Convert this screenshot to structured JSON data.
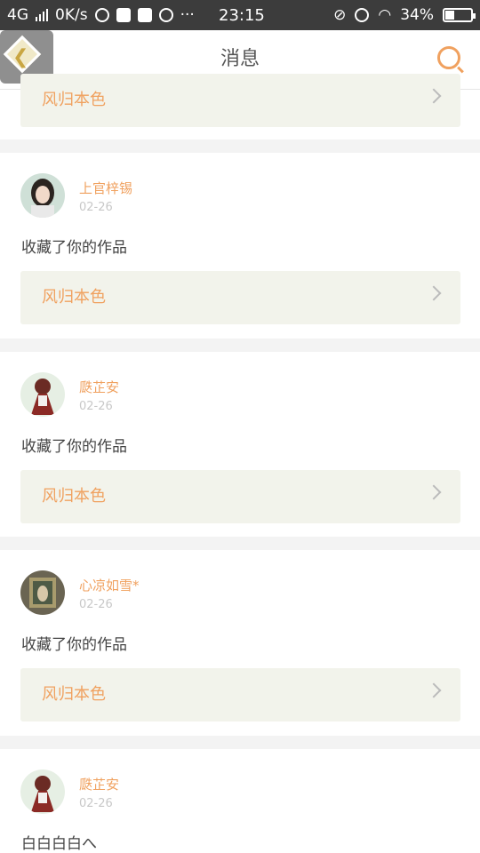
{
  "status_bar": {
    "network": "4G",
    "speed": "0K/s",
    "time": "23:15",
    "battery": "34%",
    "battery_level": 0.34,
    "left_icons": [
      "qq-icon",
      "gallery-icon",
      "chat-icon",
      "qq-icon"
    ],
    "more": "···",
    "right_icons": [
      "mute-icon",
      "alarm-icon",
      "wifi-icon"
    ]
  },
  "header": {
    "title": "消息",
    "back_icon": "back-arrow-icon",
    "search_icon": "search-icon"
  },
  "top_work": {
    "title": "风归本色"
  },
  "messages": [
    {
      "name": "上官梓锡",
      "time": "02-26",
      "text": "收藏了你的作品",
      "work_title": "风归本色"
    },
    {
      "name": "瓞芷安",
      "time": "02-26",
      "text": "收藏了你的作品",
      "work_title": "风归本色"
    },
    {
      "name": "心凉如雪*",
      "time": "02-26",
      "text": "收藏了你的作品",
      "work_title": "风归本色"
    },
    {
      "name": "瓞芷安",
      "time": "02-26",
      "text": "白白白白へ"
    }
  ],
  "colors": {
    "accent": "#f0a15f",
    "status_bar": "#3c3c3c",
    "work_bg": "#f2f3eb"
  }
}
